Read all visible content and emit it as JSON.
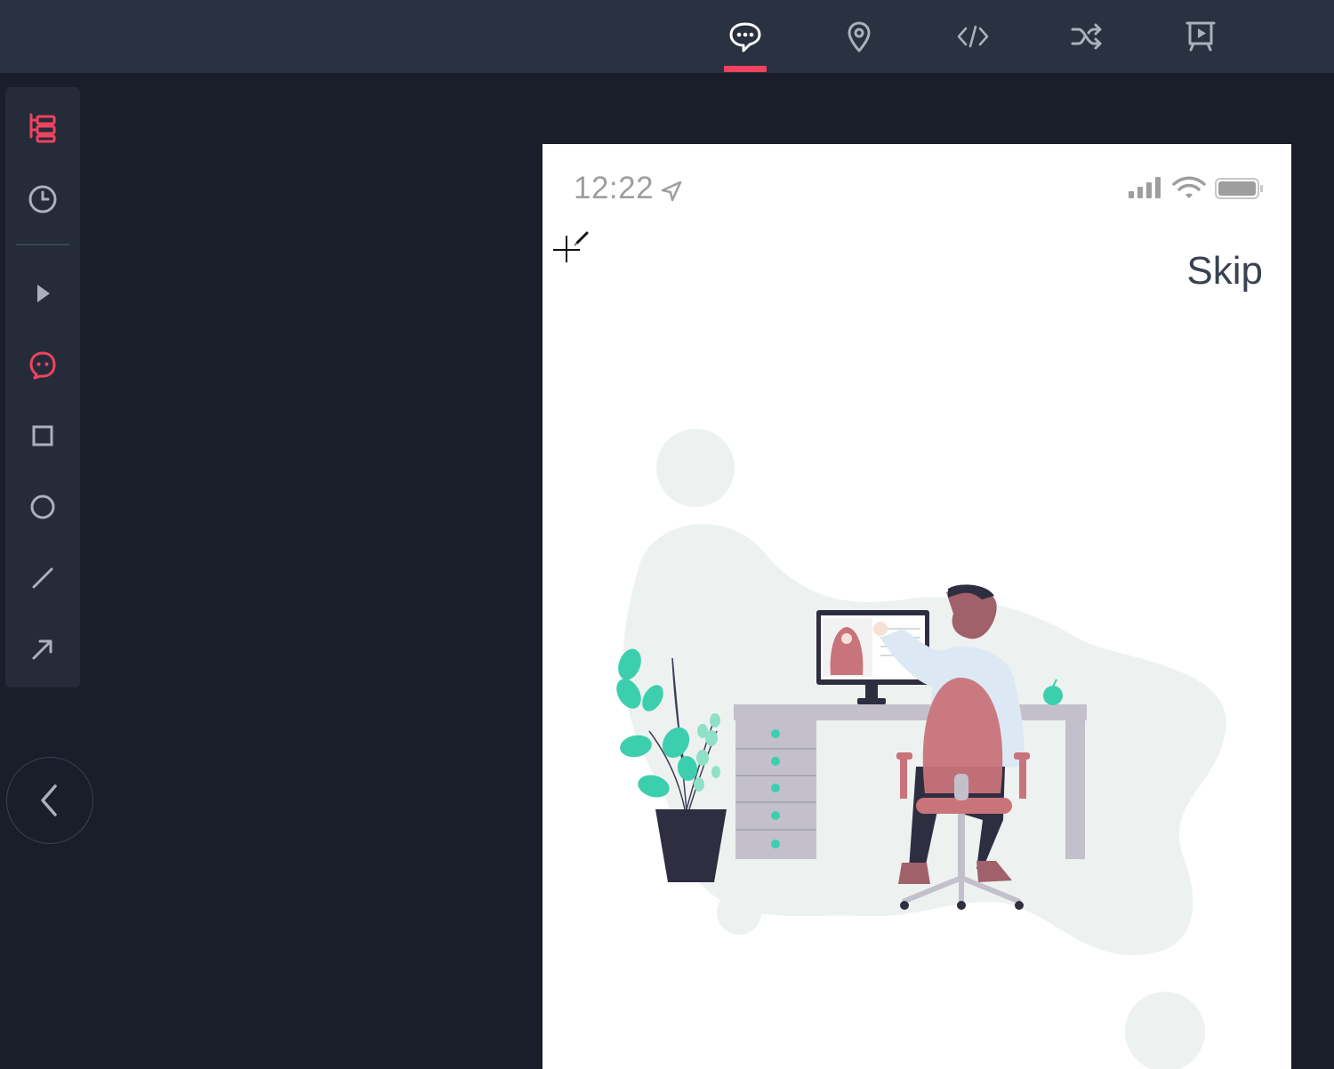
{
  "topbar": {
    "tabs": [
      {
        "icon": "chat-bubble-icon",
        "active": true
      },
      {
        "icon": "location-pin-icon",
        "active": false
      },
      {
        "icon": "code-icon",
        "active": false
      },
      {
        "icon": "shuffle-icon",
        "active": false
      },
      {
        "icon": "presentation-icon",
        "active": false
      }
    ]
  },
  "toolbar": {
    "tools": [
      {
        "icon": "layers-tree-icon",
        "active": true
      },
      {
        "icon": "history-clock-icon",
        "active": false
      },
      {
        "icon": "pointer-icon",
        "active": false
      },
      {
        "icon": "comment-icon",
        "active": true
      },
      {
        "icon": "rectangle-icon",
        "active": false
      },
      {
        "icon": "circle-icon",
        "active": false
      },
      {
        "icon": "line-icon",
        "active": false
      },
      {
        "icon": "arrow-icon",
        "active": false
      }
    ],
    "collapse_icon": "chevron-left-icon"
  },
  "phone": {
    "status_time": "12:22",
    "skip_label": "Skip"
  },
  "colors": {
    "accent": "#f0435e",
    "icon_default": "#aab0bc",
    "topbar_bg": "#2a3141",
    "canvas_bg": "#1a1e2b",
    "illustration_teal": "#3ccfae",
    "illustration_rose": "#c9737a"
  }
}
